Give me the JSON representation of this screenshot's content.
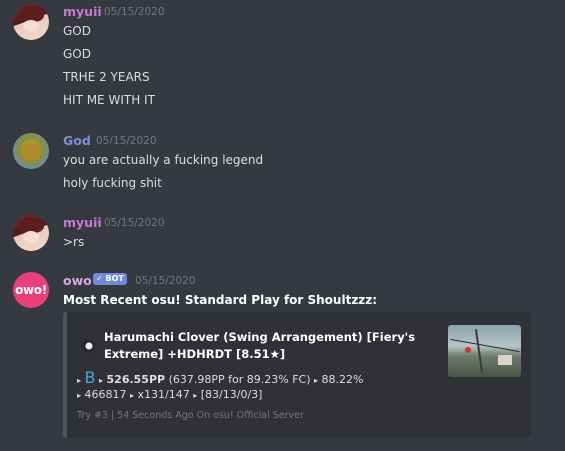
{
  "colors": {
    "myuii": "#c27bd1",
    "god": "#7e8ed8",
    "owo": "#d3a8e3",
    "bot_tag": "#7289da",
    "grade": "#4aa3df",
    "background": "#36393f",
    "embed_background": "#2f3136"
  },
  "messages": [
    {
      "author": "myuii",
      "timestamp": "05/15/2020",
      "lines": [
        "GOD",
        "GOD",
        "TRHE 2 YEARS",
        "HIT ME WITH IT"
      ]
    },
    {
      "author": "God",
      "timestamp": "05/15/2020",
      "lines": [
        "you are actually a fucking legend",
        "holy fucking shit"
      ]
    },
    {
      "author": "myuii",
      "timestamp": "05/15/2020",
      "lines": [
        ">rs"
      ]
    },
    {
      "author": "owo",
      "avatar_text": "owo!",
      "bot_tag": "✓ BOT",
      "timestamp": "05/15/2020",
      "lines": [
        "Most Recent osu! Standard Play for Shoultzzz:"
      ],
      "embed": {
        "title": "Harumachi Clover (Swing Arrangement) [Fiery's Extreme] +HDHRDT [8.51★]",
        "grade": "B",
        "pp": "526.55PP",
        "pp_detail": "(637.98PP for 89.23% FC)",
        "accuracy": "88.22%",
        "score": "466817",
        "combo": "x131/147",
        "hits": "[83/13/0/3]",
        "footer": "Try #3 | 54 Seconds Ago On osu! Official Server"
      }
    }
  ]
}
